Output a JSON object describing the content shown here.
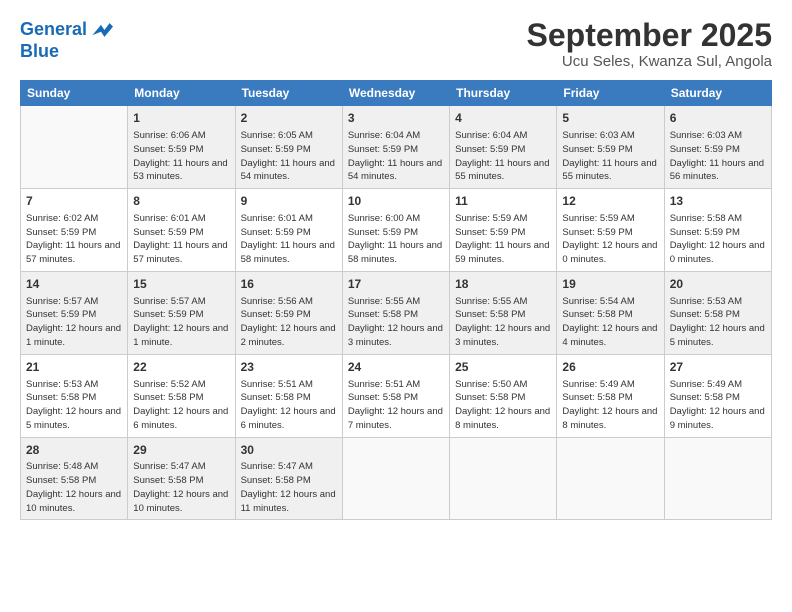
{
  "logo": {
    "line1": "General",
    "line2": "Blue"
  },
  "title": "September 2025",
  "subtitle": "Ucu Seles, Kwanza Sul, Angola",
  "headers": [
    "Sunday",
    "Monday",
    "Tuesday",
    "Wednesday",
    "Thursday",
    "Friday",
    "Saturday"
  ],
  "weeks": [
    [
      {
        "day": "",
        "info": ""
      },
      {
        "day": "1",
        "info": "Sunrise: 6:06 AM\nSunset: 5:59 PM\nDaylight: 11 hours\nand 53 minutes."
      },
      {
        "day": "2",
        "info": "Sunrise: 6:05 AM\nSunset: 5:59 PM\nDaylight: 11 hours\nand 54 minutes."
      },
      {
        "day": "3",
        "info": "Sunrise: 6:04 AM\nSunset: 5:59 PM\nDaylight: 11 hours\nand 54 minutes."
      },
      {
        "day": "4",
        "info": "Sunrise: 6:04 AM\nSunset: 5:59 PM\nDaylight: 11 hours\nand 55 minutes."
      },
      {
        "day": "5",
        "info": "Sunrise: 6:03 AM\nSunset: 5:59 PM\nDaylight: 11 hours\nand 55 minutes."
      },
      {
        "day": "6",
        "info": "Sunrise: 6:03 AM\nSunset: 5:59 PM\nDaylight: 11 hours\nand 56 minutes."
      }
    ],
    [
      {
        "day": "7",
        "info": "Sunrise: 6:02 AM\nSunset: 5:59 PM\nDaylight: 11 hours\nand 57 minutes."
      },
      {
        "day": "8",
        "info": "Sunrise: 6:01 AM\nSunset: 5:59 PM\nDaylight: 11 hours\nand 57 minutes."
      },
      {
        "day": "9",
        "info": "Sunrise: 6:01 AM\nSunset: 5:59 PM\nDaylight: 11 hours\nand 58 minutes."
      },
      {
        "day": "10",
        "info": "Sunrise: 6:00 AM\nSunset: 5:59 PM\nDaylight: 11 hours\nand 58 minutes."
      },
      {
        "day": "11",
        "info": "Sunrise: 5:59 AM\nSunset: 5:59 PM\nDaylight: 11 hours\nand 59 minutes."
      },
      {
        "day": "12",
        "info": "Sunrise: 5:59 AM\nSunset: 5:59 PM\nDaylight: 12 hours\nand 0 minutes."
      },
      {
        "day": "13",
        "info": "Sunrise: 5:58 AM\nSunset: 5:59 PM\nDaylight: 12 hours\nand 0 minutes."
      }
    ],
    [
      {
        "day": "14",
        "info": "Sunrise: 5:57 AM\nSunset: 5:59 PM\nDaylight: 12 hours\nand 1 minute."
      },
      {
        "day": "15",
        "info": "Sunrise: 5:57 AM\nSunset: 5:59 PM\nDaylight: 12 hours\nand 1 minute."
      },
      {
        "day": "16",
        "info": "Sunrise: 5:56 AM\nSunset: 5:59 PM\nDaylight: 12 hours\nand 2 minutes."
      },
      {
        "day": "17",
        "info": "Sunrise: 5:55 AM\nSunset: 5:58 PM\nDaylight: 12 hours\nand 3 minutes."
      },
      {
        "day": "18",
        "info": "Sunrise: 5:55 AM\nSunset: 5:58 PM\nDaylight: 12 hours\nand 3 minutes."
      },
      {
        "day": "19",
        "info": "Sunrise: 5:54 AM\nSunset: 5:58 PM\nDaylight: 12 hours\nand 4 minutes."
      },
      {
        "day": "20",
        "info": "Sunrise: 5:53 AM\nSunset: 5:58 PM\nDaylight: 12 hours\nand 5 minutes."
      }
    ],
    [
      {
        "day": "21",
        "info": "Sunrise: 5:53 AM\nSunset: 5:58 PM\nDaylight: 12 hours\nand 5 minutes."
      },
      {
        "day": "22",
        "info": "Sunrise: 5:52 AM\nSunset: 5:58 PM\nDaylight: 12 hours\nand 6 minutes."
      },
      {
        "day": "23",
        "info": "Sunrise: 5:51 AM\nSunset: 5:58 PM\nDaylight: 12 hours\nand 6 minutes."
      },
      {
        "day": "24",
        "info": "Sunrise: 5:51 AM\nSunset: 5:58 PM\nDaylight: 12 hours\nand 7 minutes."
      },
      {
        "day": "25",
        "info": "Sunrise: 5:50 AM\nSunset: 5:58 PM\nDaylight: 12 hours\nand 8 minutes."
      },
      {
        "day": "26",
        "info": "Sunrise: 5:49 AM\nSunset: 5:58 PM\nDaylight: 12 hours\nand 8 minutes."
      },
      {
        "day": "27",
        "info": "Sunrise: 5:49 AM\nSunset: 5:58 PM\nDaylight: 12 hours\nand 9 minutes."
      }
    ],
    [
      {
        "day": "28",
        "info": "Sunrise: 5:48 AM\nSunset: 5:58 PM\nDaylight: 12 hours\nand 10 minutes."
      },
      {
        "day": "29",
        "info": "Sunrise: 5:47 AM\nSunset: 5:58 PM\nDaylight: 12 hours\nand 10 minutes."
      },
      {
        "day": "30",
        "info": "Sunrise: 5:47 AM\nSunset: 5:58 PM\nDaylight: 12 hours\nand 11 minutes."
      },
      {
        "day": "",
        "info": ""
      },
      {
        "day": "",
        "info": ""
      },
      {
        "day": "",
        "info": ""
      },
      {
        "day": "",
        "info": ""
      }
    ]
  ]
}
